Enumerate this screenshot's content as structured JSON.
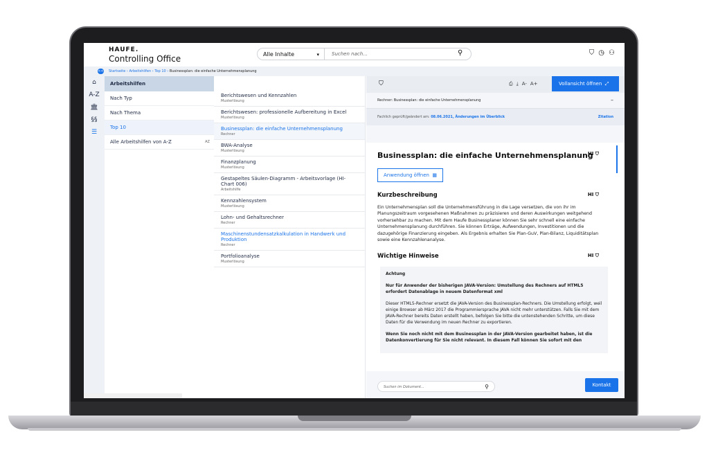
{
  "header": {
    "logo": "HAUFE.",
    "product": "Controlling Office",
    "search_scope": "Alle Inhalte",
    "search_placeholder": "Suchen nach..."
  },
  "breadcrumb": {
    "toggle": "<<",
    "items": [
      "Startseite",
      "Arbeitshilfen",
      "Top 10"
    ],
    "current": "Businessplan: die einfache Unternehmensplanung"
  },
  "rail": [
    "⌂",
    "A-Z",
    "🏛",
    "§§",
    "☰"
  ],
  "nav": {
    "head": "Arbeitshilfen",
    "items": [
      "Nach Typ",
      "Nach Thema",
      "Top 10",
      "Alle Arbeitshilfen von A-Z"
    ],
    "az_badge": "AZ"
  },
  "list": [
    {
      "title": "Berichtswesen und Kennzahlen",
      "type": "Musterlösung"
    },
    {
      "title": "Berichtswesen: professionelle Aufbereitung in Excel",
      "type": "Musterlösung"
    },
    {
      "title": "Businessplan: die einfache Unternehmensplanung",
      "type": "Rechner"
    },
    {
      "title": "BWA-Analyse",
      "type": "Musterlösung"
    },
    {
      "title": "Finanzplanung",
      "type": "Musterlösung"
    },
    {
      "title": "Gestapeltes Säulen-Diagramm - Arbeitsvorlage (HI-Chart 006)",
      "type": "Arbeitshilfe"
    },
    {
      "title": "Kennzahlensystem",
      "type": "Musterlösung"
    },
    {
      "title": "Lohn- und Gehaltsrechner",
      "type": "Rechner"
    },
    {
      "title": "Maschinenstundensatzkalkulation in Handwerk und Produktion",
      "type": "Rechner"
    },
    {
      "title": "Portfolioanalyse",
      "type": "Musterlösung"
    }
  ],
  "doc": {
    "toolbar": {
      "a_minus": "A-",
      "a_plus": "A+",
      "full_view": "Vollansicht öffnen"
    },
    "rechner_line": "Rechner: Businessplan: die einfache Unternehmensplanung",
    "checked_label": "Fachlich geprüft/geändert am:",
    "checked_date": "08.06.2021,",
    "changes_link": "Änderungen im Überblick",
    "citation": "Zitation",
    "title": "Businessplan: die einfache Unternehmensplanung",
    "hi": "HI",
    "app_button": "Anwendung öffnen",
    "section1": "Kurzbeschreibung",
    "para1": "Ein Unternehmensplan soll die Unternehmensführung in die Lage versetzen, die von ihr im Planungszeitraum vorgesehenen Maßnahmen zu präzisieren und deren Auswirkungen weitgehend vorhersehbar zu machen. Mit dem Haufe Businessplaner können Sie sehr schnell eine einfache Unternehmensplanung durchführen. Sie können Erträge, Aufwendungen, Investitionen und die dazugehörige Finanzierung eingeben. Als Ergebnis erhalten Sie Plan-GuV, Plan-Bilanz, Liquiditätsplan sowie eine Kennzahlenanalyse.",
    "section2": "Wichtige Hinweise",
    "note_title": "Achtung",
    "note_bold": "Nur für Anwender der bisherigen JAVA-Version: Umstellung des Rechners auf HTML5 erfordert Datenablage in neuem Datenformat xml",
    "note_text": "Dieser HTML5-Rechner ersetzt die JAVA-Version des Businessplan-Rechners. Die Umstellung erfolgt, weil einige Browser ab März 2017 die Programmiersprache JAVA nicht mehr unterstützen. Falls Sie mit dem JAVA-Rechner bereits Daten erstellt haben, befolgen Sie bitte die untenstehenden Schritte, um diese Daten für die Verwendung im neuen Rechner zu exportieren.",
    "note_bold2": "Wenn Sie noch nicht mit dem Businessplan in der JAVA-Version gearbeitet haben, ist die Datenkonvertierung für Sie nicht relevant. In diesem Fall können Sie sofort mit den",
    "doc_search_placeholder": "Suchen im Dokument...",
    "contact": "Kontakt"
  },
  "colors": {
    "accent": "#1a73e8",
    "nav_head": "#c9d6e6"
  }
}
